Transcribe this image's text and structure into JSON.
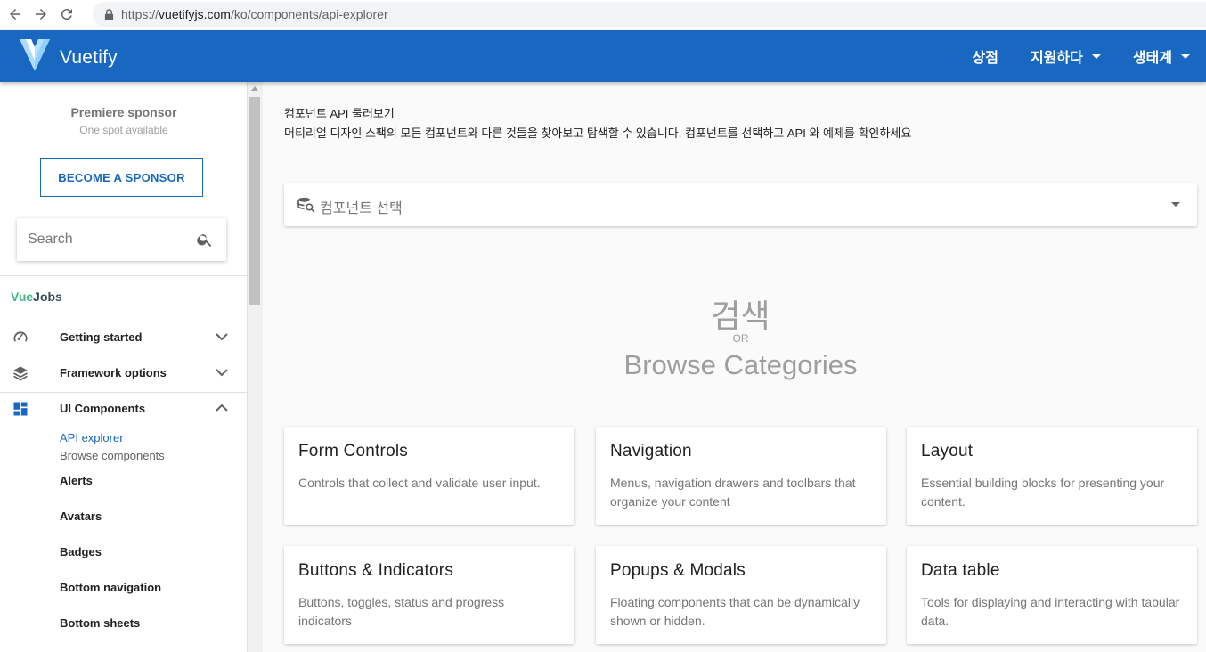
{
  "browser": {
    "url_prefix": "https://",
    "url_domain": "vuetifyjs.com",
    "url_path": "/ko/components/api-explorer"
  },
  "appbar": {
    "brand": "Vuetify",
    "color": "#1867c0",
    "nav": [
      {
        "label": "상점",
        "dropdown": false
      },
      {
        "label": "지원하다",
        "dropdown": true
      },
      {
        "label": "생태계",
        "dropdown": true
      }
    ]
  },
  "sidebar": {
    "sponsor_title": "Premiere sponsor",
    "sponsor_sub": "One spot available",
    "sponsor_button": "BECOME A SPONSOR",
    "search_placeholder": "Search",
    "vuejobs_vue": "Vue",
    "vuejobs_jobs": "Jobs",
    "groups": [
      {
        "label": "Getting started",
        "icon": "speedometer-icon",
        "expanded": false
      },
      {
        "label": "Framework options",
        "icon": "layers-icon",
        "expanded": false
      },
      {
        "label": "UI Components",
        "icon": "view-dashboard-icon",
        "expanded": true
      }
    ],
    "sub_items": [
      {
        "label": "API explorer",
        "state": "active"
      },
      {
        "label": "Browse components",
        "state": "muted"
      },
      {
        "label": "Alerts",
        "state": "bold"
      },
      {
        "label": "Avatars",
        "state": "bold"
      },
      {
        "label": "Badges",
        "state": "bold"
      },
      {
        "label": "Bottom navigation",
        "state": "bold"
      },
      {
        "label": "Bottom sheets",
        "state": "bold"
      }
    ]
  },
  "main": {
    "title": "컴포넌트 API 둘러보기",
    "description": "머티리얼 디자인 스팩의 모든 컴포넌트와 다른 것들을 찾아보고 탐색할 수 있습니다. 컴포넌트를 선택하고 API 와 예제를 확인하세요",
    "select_placeholder": "컴포넌트 선택",
    "hero_search": "검색",
    "hero_or": "OR",
    "hero_browse": "Browse Categories",
    "cards": [
      {
        "title": "Form Controls",
        "description": "Controls that collect and validate user input."
      },
      {
        "title": "Navigation",
        "description": "Menus, navigation drawers and toolbars that organize your content"
      },
      {
        "title": "Layout",
        "description": "Essential building blocks for presenting your content."
      },
      {
        "title": "Buttons & Indicators",
        "description": "Buttons, toggles, status and progress indicators"
      },
      {
        "title": "Popups & Modals",
        "description": "Floating components that can be dynamically shown or hidden."
      },
      {
        "title": "Data table",
        "description": "Tools for displaying and interacting with tabular data."
      }
    ]
  }
}
